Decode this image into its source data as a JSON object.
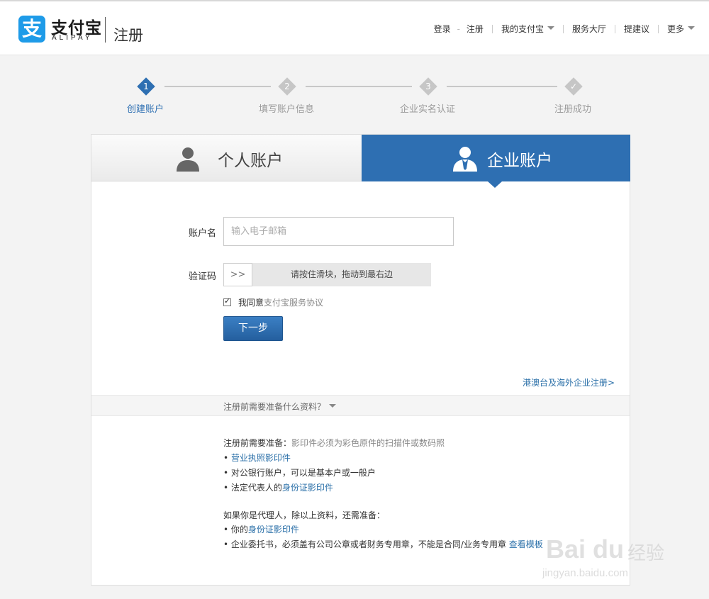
{
  "header": {
    "logo_char": "支",
    "logo_cn": "支付宝",
    "logo_en": "ALIPAY",
    "page_name": "注册",
    "nav": {
      "login": "登录",
      "sep": "-",
      "register": "注册",
      "my_alipay": "我的支付宝",
      "service_hall": "服务大厅",
      "suggestion": "提建议",
      "more": "更多"
    }
  },
  "steps": [
    {
      "num": "1",
      "label": "创建账户",
      "state": "active"
    },
    {
      "num": "2",
      "label": "填写账户信息",
      "state": "pending"
    },
    {
      "num": "3",
      "label": "企业实名认证",
      "state": "pending"
    },
    {
      "num": "✓",
      "label": "注册成功",
      "state": "pending"
    }
  ],
  "tabs": {
    "personal": "个人账户",
    "enterprise": "企业账户",
    "selected": "enterprise"
  },
  "form": {
    "account_label": "账户名",
    "account_placeholder": "输入电子邮箱",
    "captcha_label": "验证码",
    "slider_handle": ">>",
    "slider_text": "请按住滑块，拖动到最右边",
    "agree_checked": true,
    "agree_text": "我同意",
    "agree_link": "支付宝服务协议",
    "next_button": "下一步",
    "overseas_link": "港澳台及海外企业注册>"
  },
  "faq": {
    "question": "注册前需要准备什么资料？",
    "prep_title": "注册前需要准备：",
    "prep_note": "影印件必须为彩色原件的扫描件或数码照",
    "items": [
      {
        "bullet": "• ",
        "text": "",
        "link": "营业执照影印件"
      },
      {
        "bullet": "• ",
        "text": "对公银行账户，可以是基本户或一般户",
        "link": ""
      },
      {
        "bullet": "• ",
        "text": "法定代表人的",
        "link": "身份证影印件"
      }
    ],
    "agent_title": "如果你是代理人，除以上资料，还需准备：",
    "agent_items": [
      {
        "bullet": "• ",
        "text": "你的",
        "link": "身份证影印件"
      },
      {
        "bullet": "• ",
        "text": "企业委托书，必须盖有公司公章或者财务专用章，不能是合同/业务专用章 ",
        "link": "查看模板"
      }
    ]
  },
  "watermark": {
    "brand": "Bai du",
    "product": "经验",
    "url": "jingyan.baidu.com"
  },
  "colors": {
    "accent": "#2e6fb2",
    "logo_blue": "#1e9be8",
    "link": "#2a6fa8"
  }
}
